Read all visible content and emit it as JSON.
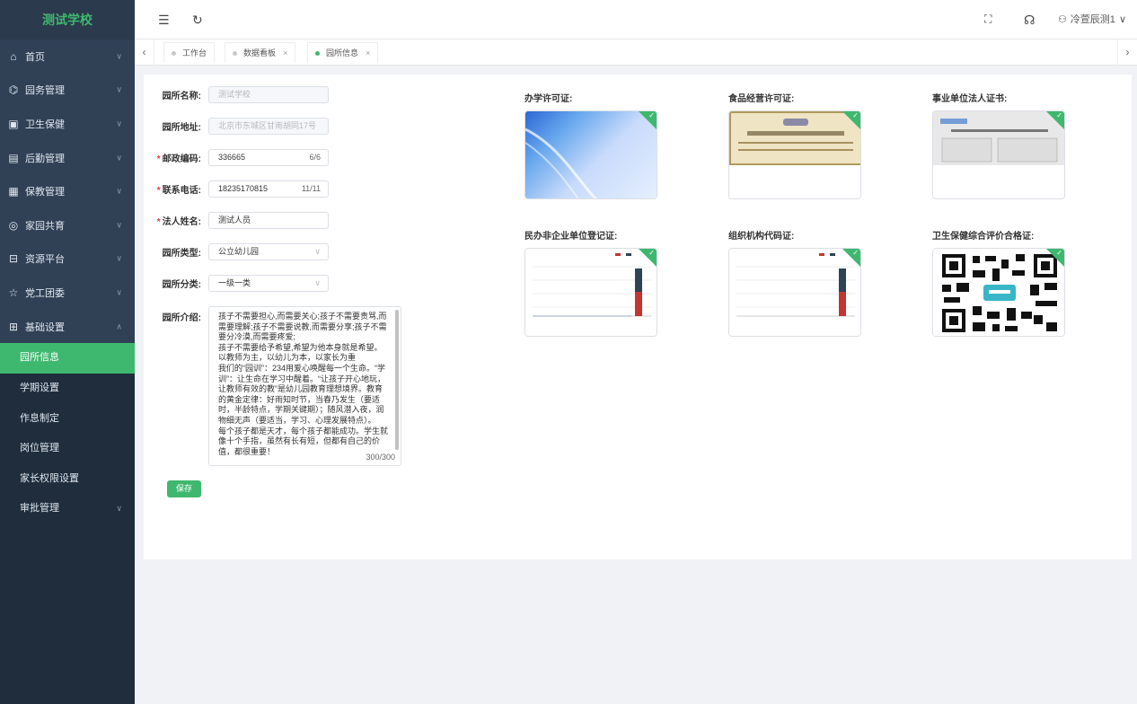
{
  "sidebar": {
    "logo": "测试学校",
    "items": [
      {
        "icon": "home-icon",
        "glyph": "⌂",
        "label": "首页",
        "chevron": "∨"
      },
      {
        "icon": "building-icon",
        "glyph": "⌬",
        "label": "园务管理",
        "chevron": "∨"
      },
      {
        "icon": "health-icon",
        "glyph": "▣",
        "label": "卫生保健",
        "chevron": "∨"
      },
      {
        "icon": "logistics-icon",
        "glyph": "▤",
        "label": "后勤管理",
        "chevron": "∨"
      },
      {
        "icon": "education-icon",
        "glyph": "▦",
        "label": "保教管理",
        "chevron": "∨"
      },
      {
        "icon": "family-icon",
        "glyph": "◎",
        "label": "家园共育",
        "chevron": "∨"
      },
      {
        "icon": "resource-icon",
        "glyph": "⊟",
        "label": "资源平台",
        "chevron": "∨"
      },
      {
        "icon": "party-icon",
        "glyph": "☆",
        "label": "党工团委",
        "chevron": "∨"
      },
      {
        "icon": "settings-grid-icon",
        "glyph": "⊞",
        "label": "基础设置",
        "chevron": "∧"
      }
    ],
    "subitems": [
      {
        "label": "园所信息",
        "active": true
      },
      {
        "label": "学期设置"
      },
      {
        "label": "作息制定"
      },
      {
        "label": "岗位管理"
      },
      {
        "label": "家长权限设置"
      },
      {
        "label": "审批管理",
        "chevron": "∨"
      }
    ]
  },
  "topbar": {
    "user_name": "冷萱辰测1",
    "user_chevron": "∨",
    "collapse_glyph": "☰",
    "refresh_glyph": "↻",
    "fullscreen_glyph": "⛶",
    "support_glyph": "☊",
    "user_glyph": "⚇"
  },
  "tabs": {
    "left_arrow": "‹",
    "right_arrow": "›",
    "items": [
      {
        "label": "工作台",
        "closable": false
      },
      {
        "label": "数据看板",
        "closable": true
      },
      {
        "label": "园所信息",
        "closable": true,
        "active": true
      }
    ],
    "close_glyph": "×"
  },
  "form": {
    "name": {
      "label": "园所名称:",
      "value": "测试学校"
    },
    "address": {
      "label": "园所地址:",
      "value": "北京市东城区甘雨胡同17号"
    },
    "postcode": {
      "label": "邮政编码:",
      "value": "336665",
      "count": "6/6"
    },
    "phone": {
      "label": "联系电话:",
      "value": "18235170815",
      "count": "11/11"
    },
    "legal": {
      "label": "法人姓名:",
      "value": "测试人员"
    },
    "type": {
      "label": "园所类型:",
      "value": "公立幼儿园",
      "arrow": "∨"
    },
    "category": {
      "label": "园所分类:",
      "value": "一级一类",
      "arrow": "∨"
    },
    "intro": {
      "label": "园所介绍:",
      "text": "孩子不需要担心,而需要关心;孩子不需要责骂,而需要理解;孩子不需要说教,而需要分享;孩子不需要分冷漠,而需要疼爱;\n孩子不需要给予希望,希望为他本身就是希望。\n以教师为主，以幼儿为本，以家长为重\n我们的“园训”：234用爱心唤醒每一个生命。“学训”：让生命在学习中醒着。“让孩子开心地玩，让教师有效的教”是幼儿园教育理想境界。教育的黄金定律：好雨知时节，当春乃发生（要适时，半龄特点，学期关键期）；随风潜入夜，润物细无声（要适当，学习、心理发展特点）。\n每个孩子都是天才，每个孩子都能成功。学生就像十个手指，虽然有长有短，但都有自己的价值，都很重要！",
      "count": "300/300"
    },
    "required_mark": "*",
    "save_label": "保存"
  },
  "certificates": [
    {
      "title": "办学许可证:",
      "kind": "blue"
    },
    {
      "title": "食品经营许可证:",
      "kind": "cert"
    },
    {
      "title": "事业单位法人证书:",
      "kind": "board"
    },
    {
      "title": "民办非企业单位登记证:",
      "kind": "chart"
    },
    {
      "title": "组织机构代码证:",
      "kind": "chart"
    },
    {
      "title": "卫生保健综合评价合格证:",
      "kind": "qr"
    }
  ],
  "check_glyph": "✓",
  "colors": {
    "accent": "#3fb86f",
    "sidebar": "#304156",
    "required": "#e53935"
  }
}
